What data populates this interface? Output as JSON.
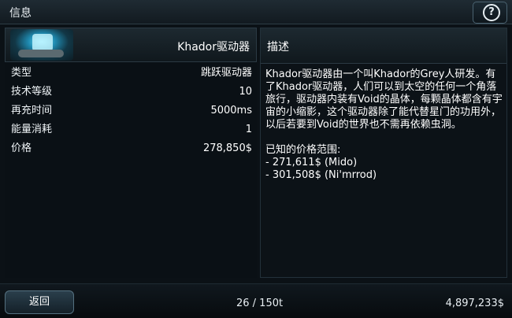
{
  "window": {
    "title": "信息",
    "help_icon": "question-mark-icon",
    "help_glyph": "?"
  },
  "item": {
    "name": "Khador驱动器",
    "icon": "khador-drive-icon",
    "stats": [
      {
        "label": "类型",
        "value": "跳跃驱动器"
      },
      {
        "label": "技术等级",
        "value": "10"
      },
      {
        "label": "再充时间",
        "value": "5000ms"
      },
      {
        "label": "能量消耗",
        "value": "1"
      },
      {
        "label": "价格",
        "value": "278,850$"
      }
    ]
  },
  "description": {
    "title": "描述",
    "text": "Khador驱动器由一个叫Khador的Grey人研发。有了Khador驱动器，人们可以到太空的任何一个角落旅行，驱动器内装有Void的晶体，每颗晶体都含有宇宙的小缩影，这个驱动器除了能代替星门的功用外，以后若要到Void的世界也不需再依赖虫洞。",
    "price_range_label": "已知的价格范围:",
    "prices": [
      "- 271,611$ (Mido)",
      "- 301,508$ (Ni'mrrod)"
    ]
  },
  "footer": {
    "back_label": "返回",
    "cargo": "26 / 150t",
    "credits": "4,897,233$"
  }
}
